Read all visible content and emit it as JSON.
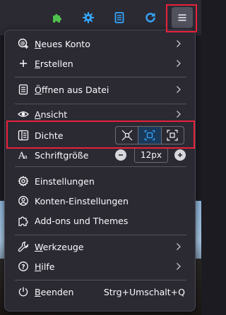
{
  "toolbar": {
    "icons": [
      "extensions-puzzle-icon",
      "gear-icon",
      "document-icon",
      "refresh-icon",
      "hamburger-menu-icon"
    ],
    "colors": {
      "puzzle": "#4fc04c",
      "accent": "#34a6ff",
      "background": "#2b2a33",
      "hamburger_active": "#52525e"
    }
  },
  "highlight_color": "#e8213b",
  "menu": {
    "new_account": {
      "pre": "",
      "accel": "N",
      "post": "eues Konto"
    },
    "create": {
      "pre": "",
      "accel": "E",
      "post": "rstellen"
    },
    "open_file": {
      "pre": "",
      "accel": "Ö",
      "post": "ffnen aus Datei"
    },
    "view": {
      "pre": "",
      "accel": "A",
      "post": "nsicht"
    },
    "density": {
      "label": "Dichte",
      "options": [
        "compact-icon",
        "normal-icon",
        "touch-icon"
      ],
      "selected": "normal-icon"
    },
    "font_size": {
      "label": "Schriftgröße",
      "value": "12px"
    },
    "settings": {
      "label": "Einstellungen"
    },
    "account_settings": {
      "label": "Konten-Einstellungen"
    },
    "addons": {
      "label": "Add-ons und Themes"
    },
    "tools": {
      "pre": "",
      "accel": "W",
      "post": "erkzeuge"
    },
    "help": {
      "pre": "",
      "accel": "H",
      "post": "ilfe"
    },
    "quit": {
      "pre": "",
      "accel": "B",
      "post": "eenden",
      "shortcut": "Strg+Umschalt+Q"
    }
  }
}
